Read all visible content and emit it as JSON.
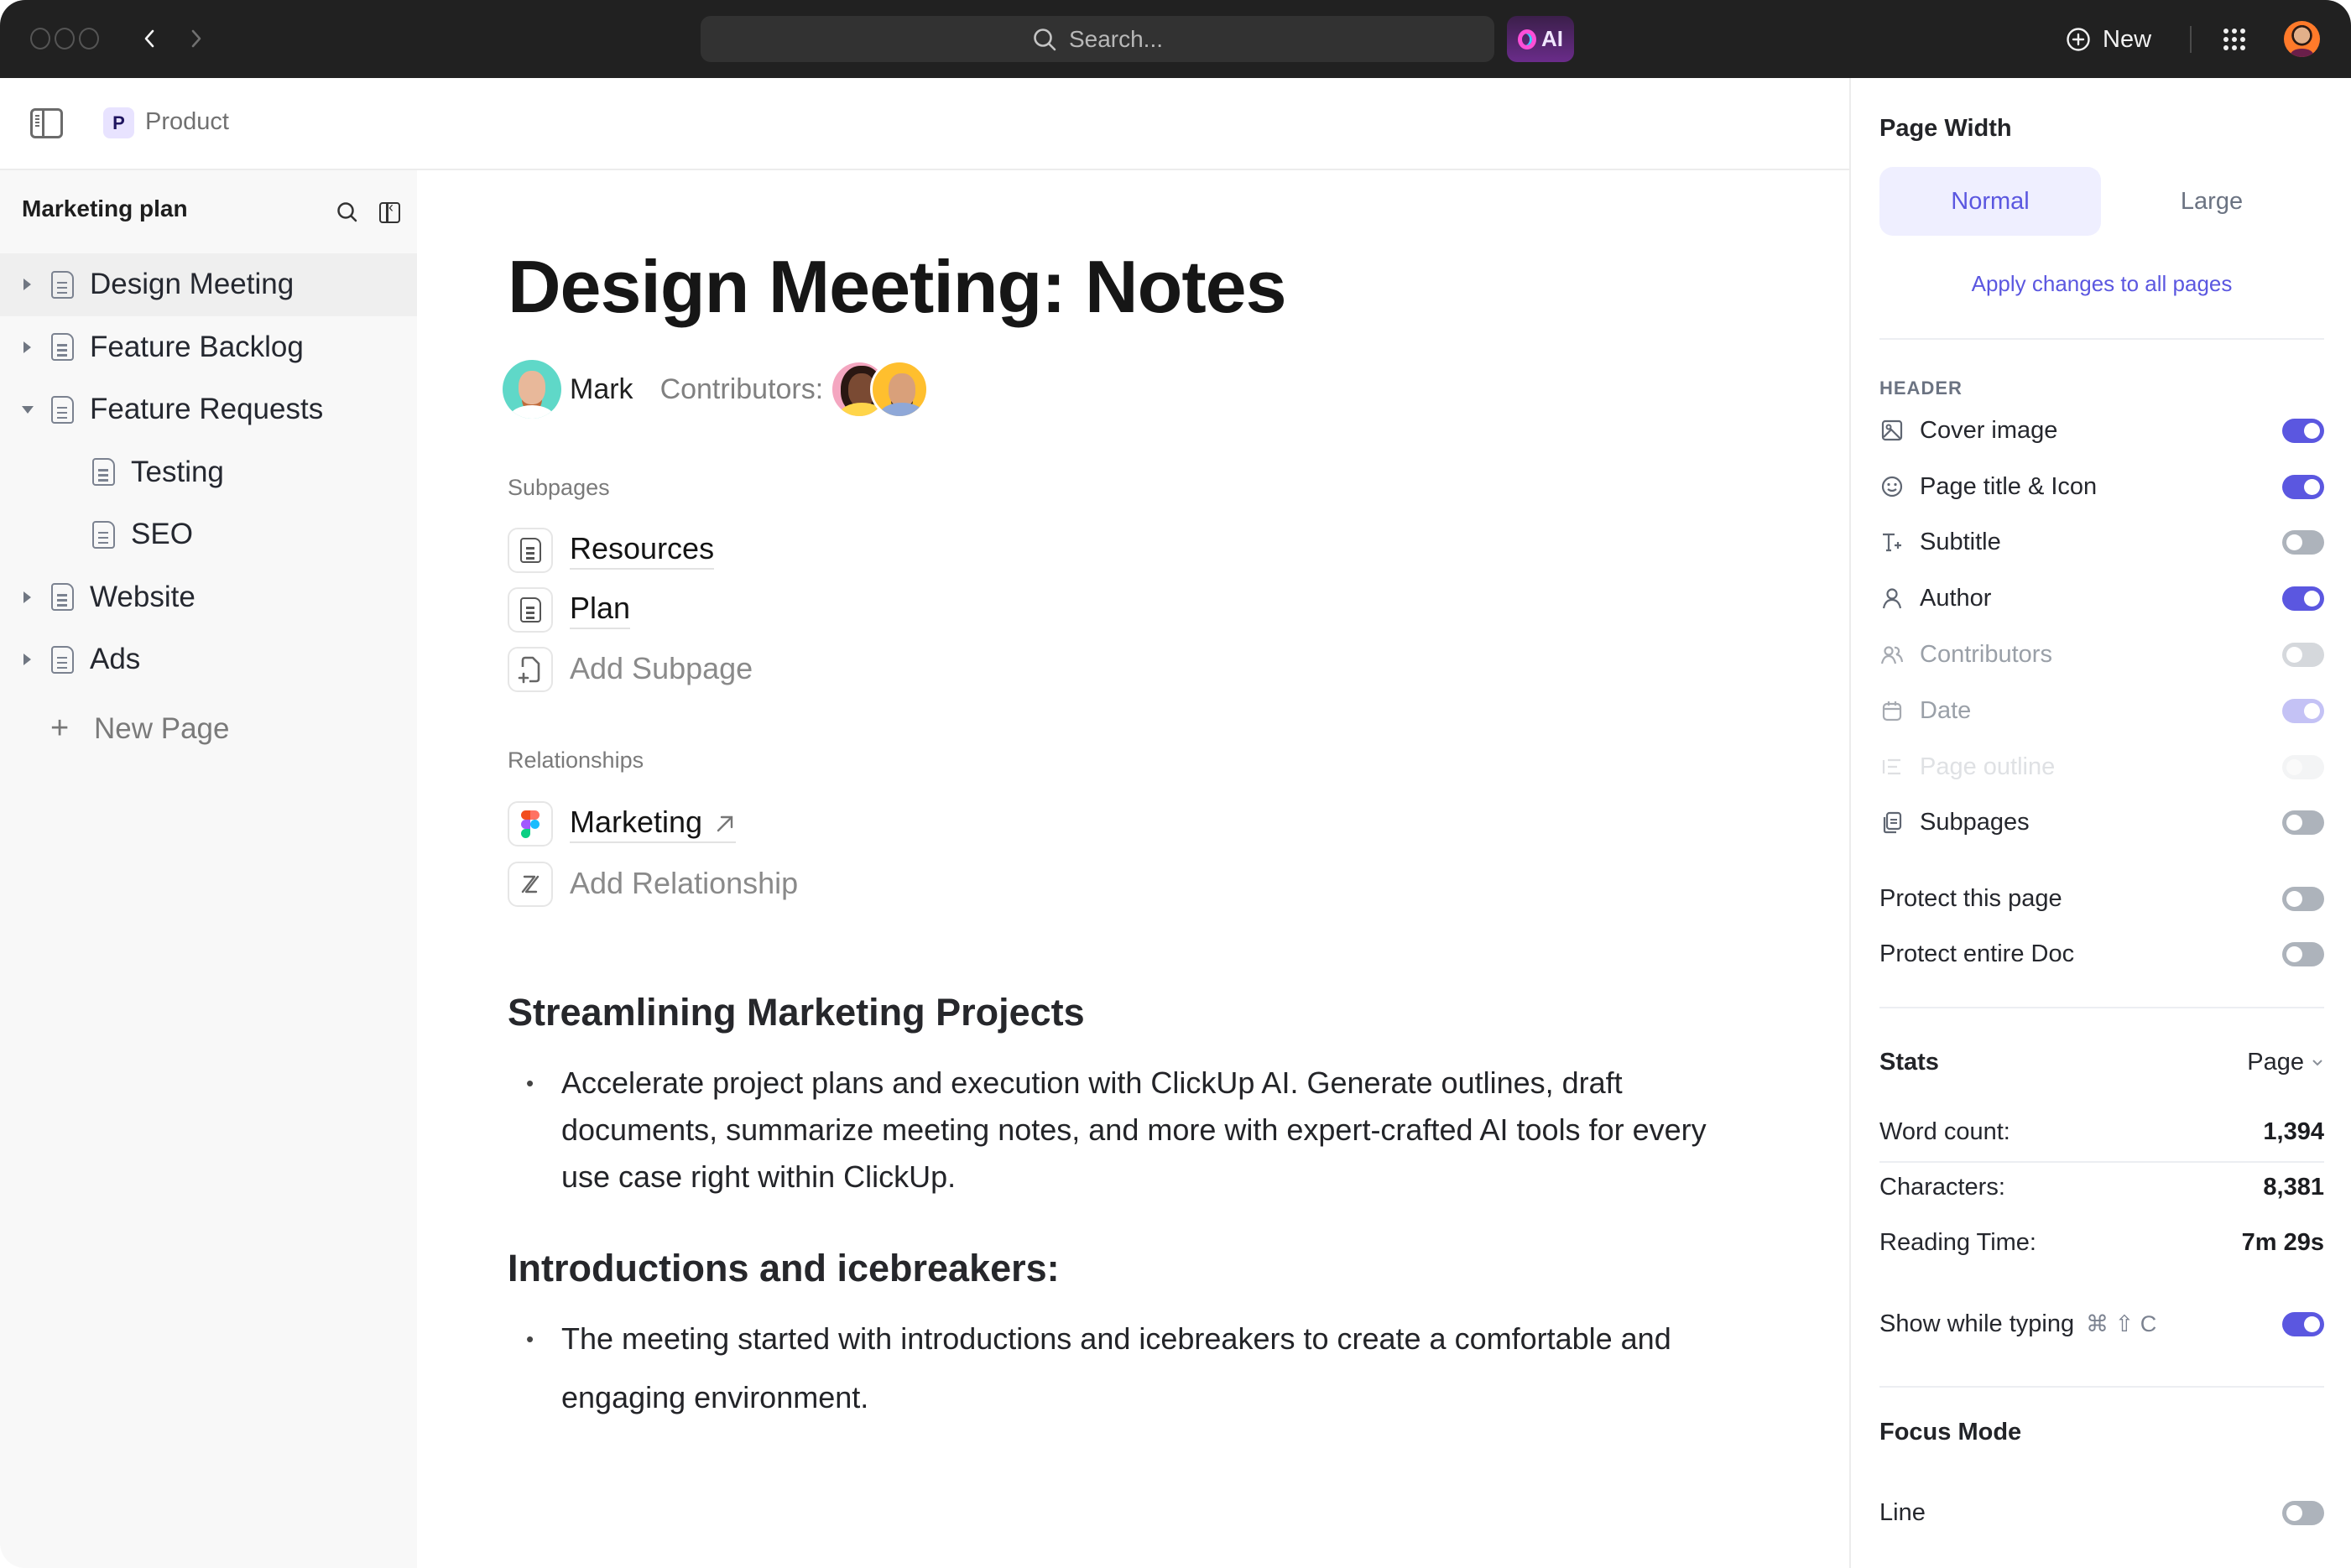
{
  "topbar": {
    "search_placeholder": "Search...",
    "ai_label": "AI",
    "new_label": "New"
  },
  "breadcrumb": {
    "space_initial": "P",
    "space_name": "Product"
  },
  "sidebar": {
    "title": "Marketing plan",
    "items": [
      {
        "label": "Design Meeting",
        "level": 0,
        "caret": "right",
        "active": true
      },
      {
        "label": "Feature Backlog",
        "level": 0,
        "caret": "right",
        "active": false
      },
      {
        "label": "Feature Requests",
        "level": 0,
        "caret": "down",
        "active": false
      },
      {
        "label": "Testing",
        "level": 1,
        "caret": "none",
        "active": false
      },
      {
        "label": "SEO",
        "level": 1,
        "caret": "none",
        "active": false
      },
      {
        "label": "Website",
        "level": 0,
        "caret": "right",
        "active": false
      },
      {
        "label": "Ads",
        "level": 0,
        "caret": "right",
        "active": false
      }
    ],
    "new_page_label": "New Page"
  },
  "doc": {
    "title": "Design Meeting: Notes",
    "author": "Mark",
    "contributors_label": "Contributors:",
    "subpages_label": "Subpages",
    "subpages": [
      "Resources",
      "Plan"
    ],
    "add_subpage_label": "Add Subpage",
    "relationships_label": "Relationships",
    "relationship": "Marketing",
    "add_relationship_label": "Add Relationship",
    "sections": [
      {
        "heading": "Streamlining Marketing Projects",
        "bullet": "Accelerate project plans and execution with ClickUp AI. Generate outlines, draft documents, summarize meeting notes, and more with expert-crafted AI tools for every use case right within ClickUp."
      },
      {
        "heading": "Introductions and icebreakers:",
        "bullet": "The meeting started with introductions and icebreakers to create a comfortable and engaging environment."
      }
    ]
  },
  "panel": {
    "page_width_title": "Page Width",
    "width_options": [
      "Normal",
      "Large"
    ],
    "width_selected": "Normal",
    "apply_all_label": "Apply changes to all pages",
    "header_caption": "HEADER",
    "header_options": [
      {
        "label": "Cover image",
        "icon": "image-icon",
        "on": true,
        "state": "enabled"
      },
      {
        "label": "Page title & Icon",
        "icon": "smiley-icon",
        "on": true,
        "state": "enabled"
      },
      {
        "label": "Subtitle",
        "icon": "text-plus-icon",
        "on": false,
        "state": "enabled"
      },
      {
        "label": "Author",
        "icon": "user-icon",
        "on": true,
        "state": "enabled"
      },
      {
        "label": "Contributors",
        "icon": "users-icon",
        "on": false,
        "state": "dimmed"
      },
      {
        "label": "Date",
        "icon": "calendar-icon",
        "on": true,
        "state": "dimmed"
      },
      {
        "label": "Page outline",
        "icon": "outline-icon",
        "on": false,
        "state": "disabled"
      },
      {
        "label": "Subpages",
        "icon": "pages-icon",
        "on": false,
        "state": "enabled"
      }
    ],
    "protect_options": [
      {
        "label": "Protect this page",
        "on": false
      },
      {
        "label": "Protect entire Doc",
        "on": false
      }
    ],
    "stats": {
      "title": "Stats",
      "scope": "Page",
      "rows": [
        {
          "label": "Word count:",
          "value": "1,394"
        },
        {
          "label": "Characters:",
          "value": "8,381"
        },
        {
          "label": "Reading Time:",
          "value": "7m 29s"
        }
      ],
      "show_while_typing_label": "Show while typing",
      "shortcut": "⌘ ⇧ C",
      "show_while_typing_on": true
    },
    "focus_mode": {
      "title": "Focus Mode",
      "line_label": "Line",
      "line_on": false
    }
  },
  "colors": {
    "accent": "#5b57e0",
    "topbar_bg": "#212121",
    "sidebar_bg": "#f8f8f8"
  }
}
